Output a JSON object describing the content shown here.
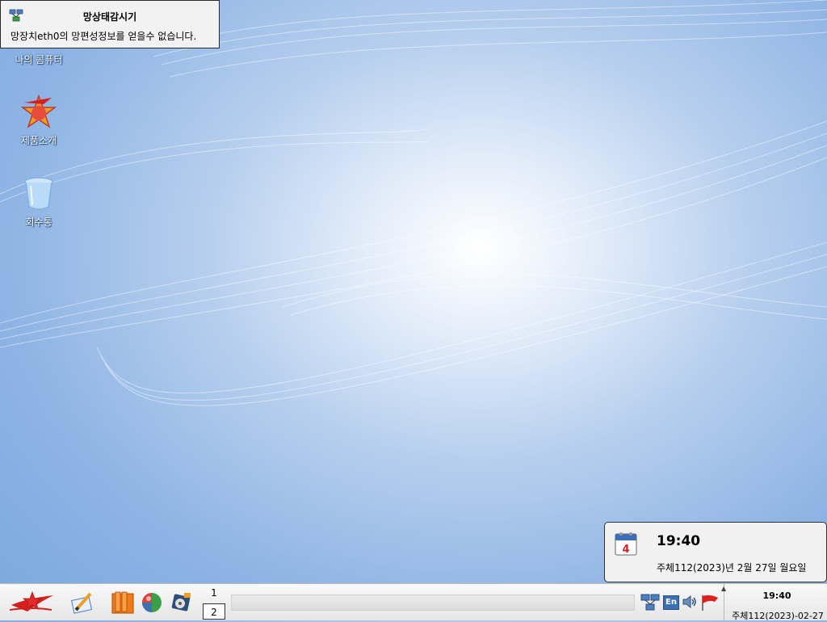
{
  "notification": {
    "title": "망상태감시기",
    "message": "망장치eth0의 망편성정보를 얻을수 없습니다."
  },
  "desktop": {
    "icons": [
      {
        "label": "나의 콤퓨터",
        "icon": "computer-icon"
      },
      {
        "label": "제품소개",
        "icon": "product-intro-icon"
      },
      {
        "label": "회수통",
        "icon": "trash-icon"
      }
    ]
  },
  "clock_popup": {
    "time": "19:40",
    "date": "주체112(2023)년 2월 27일 월요일",
    "calendar_day": "4"
  },
  "taskbar": {
    "launchers": [
      "start-menu-icon",
      "text-editor-icon",
      "file-manager-icon",
      "web-browser-icon",
      "media-player-icon"
    ],
    "workspaces": [
      "1",
      "2"
    ],
    "active_workspace": "2",
    "tray": {
      "network_icon": "network-icon",
      "input_method": "En",
      "volume_icon": "volume-icon",
      "flag_icon": "flag-icon"
    },
    "clock_time": "19:40",
    "clock_date": "주체112(2023)-02-27"
  },
  "colors": {
    "desktop_bg": "#8eb4e4",
    "taskbar_bg": "#efefef",
    "popup_bg": "#f1f1f1"
  }
}
